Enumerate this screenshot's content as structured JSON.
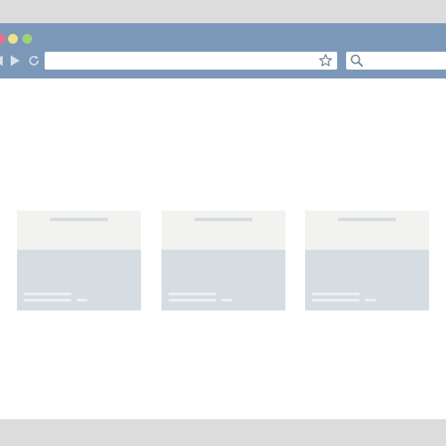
{
  "window_controls": [
    "close",
    "minimize",
    "maximize"
  ],
  "colors": {
    "chrome": "#7b98b8",
    "close": "#e4718a",
    "minimize": "#f0e28a",
    "maximize": "#9fd07a",
    "card_body": "#d5dde3",
    "card_head": "#f2f3f0"
  },
  "toolbar": {
    "back_icon": "back-icon",
    "forward_icon": "forward-icon",
    "reload_icon": "reload-icon",
    "address_value": "",
    "bookmark_icon": "star-icon",
    "search_value": "",
    "search_icon": "search-icon"
  },
  "cards": [
    {
      "title": "",
      "lines": [
        "",
        ""
      ],
      "meta": ""
    },
    {
      "title": "",
      "lines": [
        "",
        ""
      ],
      "meta": ""
    },
    {
      "title": "",
      "lines": [
        "",
        ""
      ],
      "meta": ""
    }
  ]
}
